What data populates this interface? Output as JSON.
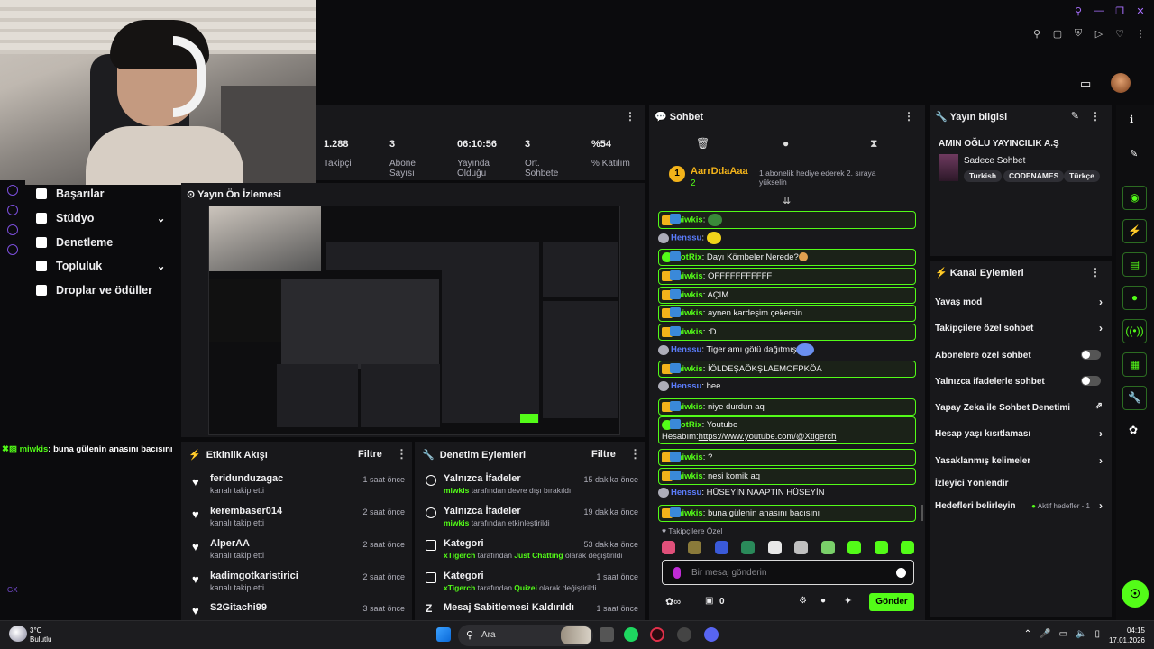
{
  "stats": [
    {
      "value": "1.288",
      "label": "Takipçi"
    },
    {
      "value": "3",
      "label": "Abone Sayısı"
    },
    {
      "value": "06:10:56",
      "label": "Yayında Olduğu"
    },
    {
      "value": "3",
      "label": "Ort. Sohbete"
    },
    {
      "value": "%54",
      "label": "% Katılım"
    }
  ],
  "nav": [
    {
      "label": "Başarılar"
    },
    {
      "label": "Stüdyo"
    },
    {
      "label": "Denetleme"
    },
    {
      "label": "Topluluk"
    },
    {
      "label": "Droplar ve ödüller"
    }
  ],
  "left_chat": {
    "user": "miwkis",
    "text": ": buna gülenin anasını bacısını"
  },
  "preview": {
    "title": "Yayın Ön İzlemesi"
  },
  "activity": {
    "title": "Etkinlik Akışı",
    "filter": "Filtre",
    "items": [
      {
        "name": "feridunduzagac",
        "sub": "kanalı takip etti",
        "time": "1 saat önce"
      },
      {
        "name": "kerembaser014",
        "sub": "kanalı takip etti",
        "time": "2 saat önce"
      },
      {
        "name": "AlperAA",
        "sub": "kanalı takip etti",
        "time": "2 saat önce"
      },
      {
        "name": "kadimgotkaristirici",
        "sub": "kanalı takip etti",
        "time": "2 saat önce"
      },
      {
        "name": "S2Gitachi99",
        "sub": "",
        "time": "3 saat önce"
      }
    ]
  },
  "moderation": {
    "title": "Denetim Eylemleri",
    "filter": "Filtre",
    "items": [
      {
        "name": "Yalnızca İfadeler",
        "who": "miwkis",
        "sub": " tarafından devre dışı bırakıldı",
        "extra": "",
        "tail": "",
        "time": "15 dakika önce"
      },
      {
        "name": "Yalnızca İfadeler",
        "who": "miwkis",
        "sub": " tarafından etkinleştirildi",
        "extra": "",
        "tail": "",
        "time": "19 dakika önce"
      },
      {
        "name": "Kategori",
        "who": "xTigerch",
        "sub": " tarafından ",
        "extra": "Just Chatting",
        "tail": " olarak değiştirildi",
        "time": "53 dakika önce"
      },
      {
        "name": "Kategori",
        "who": "xTigerch",
        "sub": " tarafından ",
        "extra": "Quizei",
        "tail": " olarak değiştirildi",
        "time": "1 saat önce"
      },
      {
        "name": "Mesaj Sabitlemesi Kaldırıldı",
        "who": "",
        "sub": "",
        "extra": "",
        "tail": "",
        "time": "1 saat önce"
      }
    ]
  },
  "chat": {
    "title": "Sohbet",
    "pinned": {
      "user": "AarrDdaAaa",
      "count": "2",
      "rank": "1",
      "text": "1 abonelik hediye ederek 2. sıraya yükselin"
    },
    "messages": [
      {
        "user": "miwkis",
        "text": ": ",
        "type": "mod"
      },
      {
        "user": "Henssu",
        "text": ": ",
        "type": "plain"
      },
      {
        "user": "BotRix",
        "text": ": Dayı Kömbeler Nerede?",
        "type": "bot"
      },
      {
        "user": "miwkis",
        "text": ": OFFFFFFFFFFF",
        "type": "mod"
      },
      {
        "user": "miwkis",
        "text": ": AÇIM",
        "type": "mod"
      },
      {
        "user": "miwkis",
        "text": ": aynen kardeşim çekersin",
        "type": "mod"
      },
      {
        "user": "miwkis",
        "text": ": :D",
        "type": "mod"
      },
      {
        "user": "Henssu",
        "text": ": Tiger amı götü dağıtmış",
        "type": "plain"
      },
      {
        "user": "miwkis",
        "text": ": İÖLDEŞAÖKŞLAEMOFPKÖA",
        "type": "mod"
      },
      {
        "user": "Henssu",
        "text": ": hee",
        "type": "plain"
      },
      {
        "user": "miwkis",
        "text": ": niye durdun aq",
        "type": "mod"
      },
      {
        "user": "BotRix",
        "text": ": Youtube",
        "type": "bot2"
      },
      {
        "user": "miwkis",
        "text": ": ?",
        "type": "mod"
      },
      {
        "user": "miwkis",
        "text": ": nesi komik aq",
        "type": "mod"
      },
      {
        "user": "Henssu",
        "text": ": HÜSEYİN NAAPTIN HÜSEYİN",
        "type": "plain"
      },
      {
        "user": "miwkis",
        "text": ": buna gülenin anasını bacısını",
        "type": "mod"
      }
    ],
    "bot_link_prefix": "Hesabım:",
    "bot_link": "https://www.youtube.com/@Xtigerch",
    "followers_only": "Takipçilere Özel",
    "placeholder": "Bir mesaj gönderin",
    "points": "0",
    "send": "Gönder"
  },
  "info": {
    "title": "Yayın bilgisi",
    "stream_title": "AMIN OĞLU YAYINCILIK A.Ş",
    "category": "Sadece Sohbet",
    "tags": [
      "Turkish",
      "CODENAMES",
      "Türkçe"
    ]
  },
  "actions": {
    "title": "Kanal Eylemleri",
    "items": [
      {
        "label": "Yavaş mod",
        "control": "arrow"
      },
      {
        "label": "Takipçilere özel sohbet",
        "control": "arrow"
      },
      {
        "label": "Abonelere özel sohbet",
        "control": "toggle"
      },
      {
        "label": "Yalnızca ifadelerle sohbet",
        "control": "toggle"
      },
      {
        "label": "Yapay Zeka ile Sohbet Denetimi",
        "control": "external"
      },
      {
        "label": "Hesap yaşı kısıtlaması",
        "control": "arrow"
      },
      {
        "label": "Yasaklanmış kelimeler",
        "control": "arrow"
      },
      {
        "label": "İzleyici Yönlendir",
        "control": "none"
      },
      {
        "label": "Hedefleri belirleyin",
        "control": "arrow",
        "status": "Aktif hedefler - 1"
      }
    ]
  },
  "taskbar": {
    "temp": "3°C",
    "weather": "Bulutlu",
    "search": "Ara",
    "time": "04:15",
    "date": "17.01.2026"
  },
  "left_footer": "GX",
  "colors": {
    "accent": "#53fc18",
    "panel": "#18181b",
    "bg": "#0b0b0d",
    "purple": "#a970ff"
  }
}
